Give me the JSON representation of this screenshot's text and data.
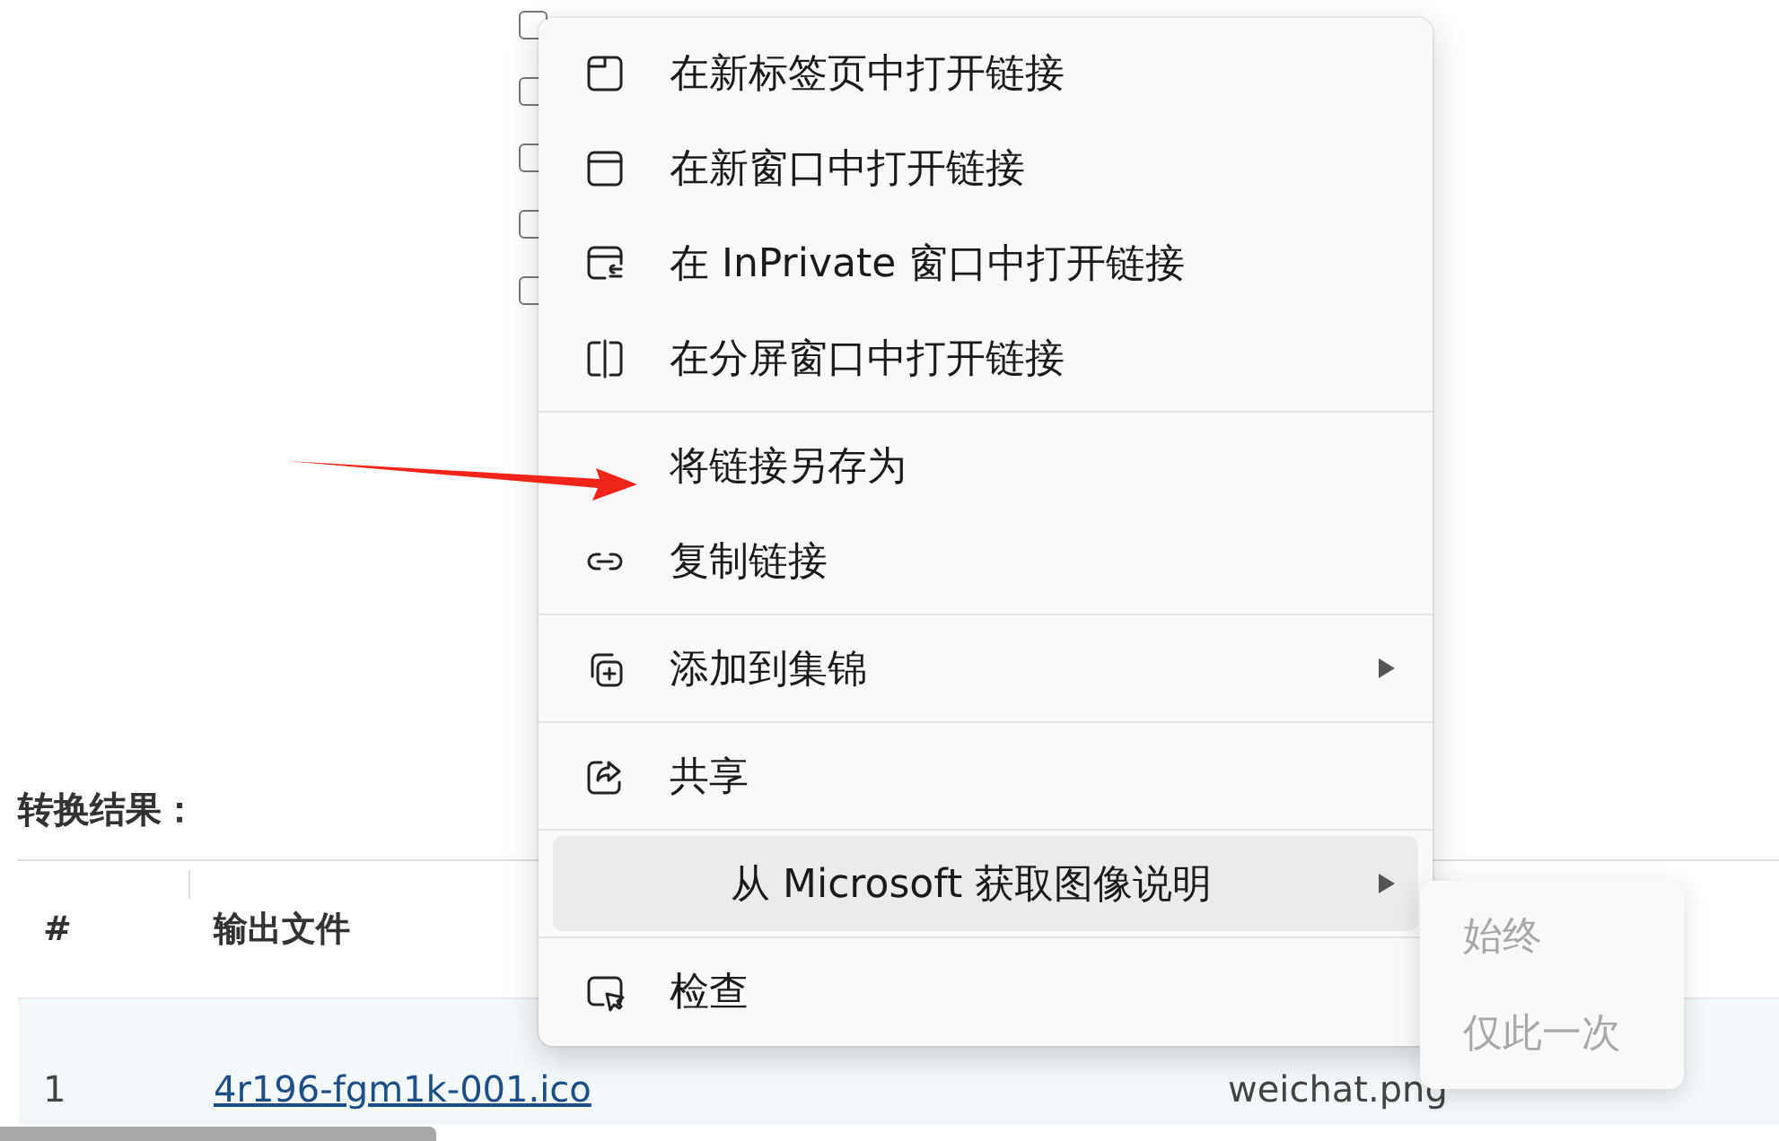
{
  "page": {
    "checkboxes": [
      {
        "checked": false
      },
      {
        "checked": false
      },
      {
        "checked": false
      },
      {
        "checked": false
      },
      {
        "checked": false
      }
    ],
    "heading": "转换结果：",
    "table": {
      "columns": [
        "#",
        "输出文件"
      ],
      "rows": [
        {
          "cells": [
            "1",
            "4r196-fgm1k-001.ico",
            "weichat.png"
          ]
        }
      ]
    }
  },
  "context_menu": {
    "items": [
      {
        "kind": "item",
        "label": "在新标签页中打开链接",
        "selected": false,
        "submenu": false
      },
      {
        "kind": "item",
        "label": "在新窗口中打开链接",
        "selected": false,
        "submenu": false
      },
      {
        "kind": "item",
        "label": "在 InPrivate 窗口中打开链接",
        "selected": false,
        "submenu": false
      },
      {
        "kind": "item",
        "label": "在分屏窗口中打开链接",
        "selected": false,
        "submenu": false
      },
      {
        "kind": "separator"
      },
      {
        "kind": "item",
        "label": "将链接另存为",
        "selected": false,
        "submenu": false
      },
      {
        "kind": "item",
        "label": "复制链接",
        "selected": false,
        "submenu": false
      },
      {
        "kind": "separator"
      },
      {
        "kind": "item",
        "label": "添加到集锦",
        "selected": false,
        "submenu": true
      },
      {
        "kind": "separator"
      },
      {
        "kind": "item",
        "label": "共享",
        "selected": false,
        "submenu": false
      },
      {
        "kind": "separator"
      },
      {
        "kind": "item",
        "label": "从 Microsoft 获取图像说明",
        "selected": true,
        "submenu": true
      },
      {
        "kind": "separator"
      },
      {
        "kind": "item",
        "label": "检查",
        "selected": false,
        "submenu": false
      }
    ]
  },
  "submenu": {
    "items": [
      {
        "label": "始终",
        "disabled": true
      },
      {
        "label": "仅此一次",
        "disabled": true
      }
    ]
  }
}
